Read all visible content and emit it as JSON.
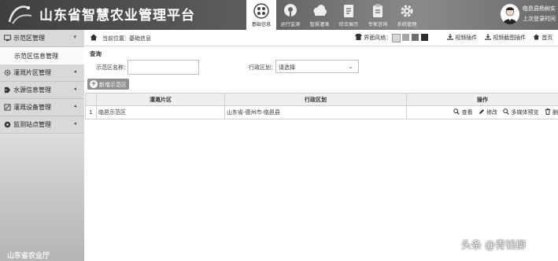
{
  "header": {
    "app_title": "山东省智慧农业管理平台",
    "nav": [
      {
        "label": "基础信息",
        "icon": "grid-icon",
        "active": true
      },
      {
        "label": "运行监测",
        "icon": "map-pin-icon",
        "active": false
      },
      {
        "label": "智慧灌溉",
        "icon": "cloud-icon",
        "active": false
      },
      {
        "label": "综合展示",
        "icon": "document-icon",
        "active": false
      },
      {
        "label": "专家咨询",
        "icon": "clipboard-icon",
        "active": false
      },
      {
        "label": "系统管理",
        "icon": "gear-icon",
        "active": false
      }
    ],
    "user_name": "临邑县杨树实",
    "last_login": "上次登录时间"
  },
  "sidebar": {
    "items": [
      {
        "label": "示范区管理",
        "icon": "monitor-icon",
        "expanded": true
      },
      {
        "label": "灌溉片区管理",
        "icon": "gear-icon"
      },
      {
        "label": "水源信息管理",
        "icon": "tag-icon"
      },
      {
        "label": "灌溉设备管理",
        "icon": "tools-icon"
      },
      {
        "label": "监测站点管理",
        "icon": "station-icon"
      }
    ],
    "sub_item": "示范区信息管理",
    "footer": "山东省农业厅"
  },
  "breadcrumb": {
    "label": "当前位置：",
    "page": "基础信息"
  },
  "toolbar": {
    "theme_label": "界面风格：",
    "theme_colors": [
      "#d6d6d6",
      "#a6a6a6",
      "#6e6e6e",
      "#2e2e2e"
    ],
    "video_plugin": "视频插件",
    "video_capture_plugin": "视频截图插件",
    "home": "首页"
  },
  "query": {
    "title": "查询",
    "name_label": "示范区名称：",
    "name_value": "",
    "district_label": "行政区划：",
    "district_value": "请选择"
  },
  "add_button": "新增示范区",
  "table": {
    "columns": [
      "灌溉片区",
      "行政区划",
      "操作"
    ],
    "rows": [
      {
        "index": "1",
        "area": "临邑示范区",
        "district": "山东省-德州市-临邑县"
      }
    ],
    "actions": [
      {
        "label": "查看",
        "icon": "search-icon"
      },
      {
        "label": "修改",
        "icon": "pencil-icon"
      },
      {
        "label": "多媒体预览",
        "icon": "search-icon"
      },
      {
        "label": "删",
        "icon": "trash-icon"
      }
    ]
  },
  "watermark": "头条 @青钱柳"
}
